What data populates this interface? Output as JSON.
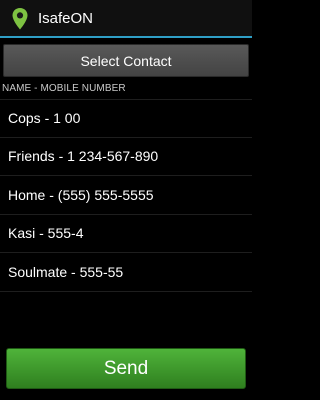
{
  "app": {
    "title": "IsafeON",
    "icon": "map-pin-icon",
    "accent_color": "#2f9fc6"
  },
  "select_contact": {
    "label": "Select Contact"
  },
  "list": {
    "header": "NAME - MOBILE NUMBER",
    "items": [
      {
        "label": "Cops - 1 00"
      },
      {
        "label": "Friends - 1 234-567-890"
      },
      {
        "label": "Home - (555) 555-5555"
      },
      {
        "label": "Kasi - 555-4"
      },
      {
        "label": "Soulmate - 555-55"
      }
    ]
  },
  "send": {
    "label": "Send",
    "color": "#3f9a2c"
  }
}
